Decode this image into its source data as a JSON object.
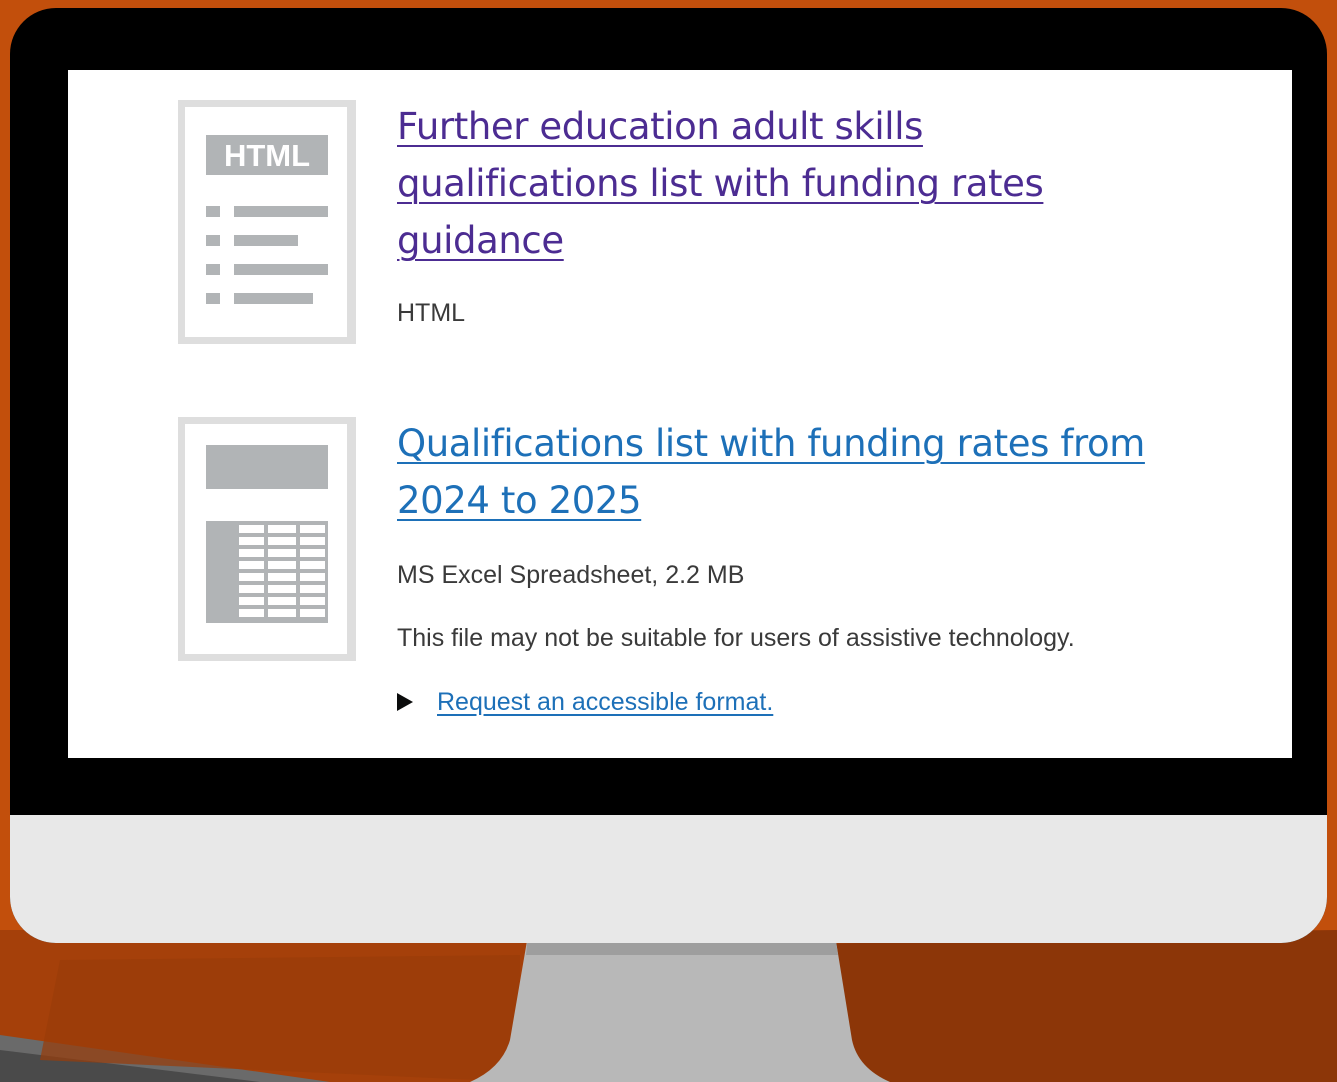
{
  "attachments": [
    {
      "thumbnail_label": "HTML",
      "thumbnail_icon": "html-document-icon",
      "title": "Further education adult skills qualifications list with funding rates guidance",
      "format": "HTML"
    },
    {
      "thumbnail_icon": "spreadsheet-document-icon",
      "title": "Qualifications list with funding rates from 2024 to 2025",
      "format": "MS Excel Spreadsheet, 2.2 MB",
      "warning": "This file may not be suitable for users of assistive technology.",
      "request_link": "Request an accessible format."
    }
  ],
  "colors": {
    "background": "#c24f0c",
    "visited_link": "#4c2c92",
    "link": "#1d70b8",
    "bezel": "#000000",
    "chin": "#e8e8e8",
    "stand": "#b1b1b1"
  }
}
